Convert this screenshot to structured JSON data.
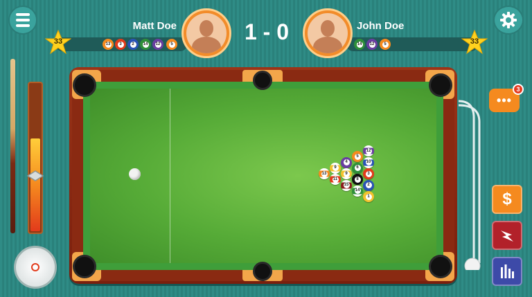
{
  "header": {
    "player1": {
      "name": "Matt Doe",
      "level": "33",
      "balls": [
        "13",
        "3",
        "2",
        "14",
        "12",
        "5"
      ]
    },
    "player2": {
      "name": "John Doe",
      "level": "33",
      "balls": [
        "14",
        "12",
        "5"
      ]
    },
    "score": "1 - 0"
  },
  "chat": {
    "badge_count": "3"
  },
  "side_buttons": {
    "shop_label": "$"
  },
  "rack": [
    {
      "n": "13",
      "color": "#f58a1f",
      "stripe": true
    },
    {
      "n": "9",
      "color": "#f3c22e",
      "stripe": true
    },
    {
      "n": "11",
      "color": "#e23b1b",
      "stripe": true
    },
    {
      "n": "4",
      "color": "#6a3ea1",
      "stripe": false
    },
    {
      "n": "9",
      "color": "#f3c22e",
      "stripe": true
    },
    {
      "n": "15",
      "color": "#8b1e1e",
      "stripe": true
    },
    {
      "n": "5",
      "color": "#f58a1f",
      "stripe": false
    },
    {
      "n": "6",
      "color": "#2f8f3a",
      "stripe": false
    },
    {
      "n": "8",
      "color": "#111111",
      "stripe": false
    },
    {
      "n": "14",
      "color": "#2f8f3a",
      "stripe": true
    },
    {
      "n": "12",
      "color": "#6a3ea1",
      "stripe": true
    },
    {
      "n": "10",
      "color": "#2a53b5",
      "stripe": true
    },
    {
      "n": "3",
      "color": "#e23b1b",
      "stripe": false
    },
    {
      "n": "2",
      "color": "#2a53b5",
      "stripe": false
    },
    {
      "n": "1",
      "color": "#f3c22e",
      "stripe": false
    }
  ],
  "colors": {
    "felt": "#56ab37",
    "rail": "#8a2a12",
    "accent": "#f58a1f"
  },
  "power_level": 0.62
}
